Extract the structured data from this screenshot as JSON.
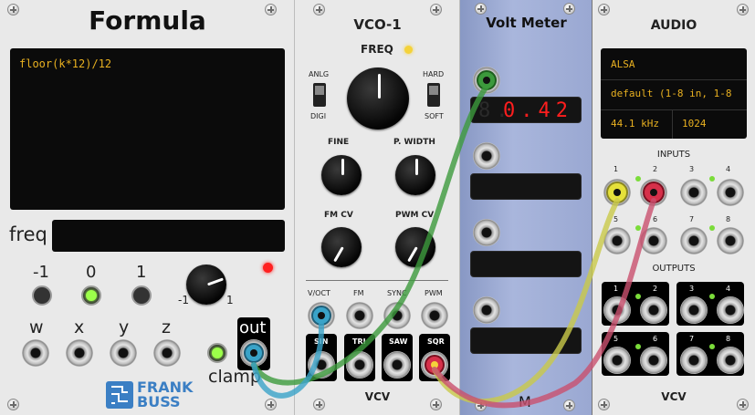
{
  "formula": {
    "title": "Formula",
    "expression": "floor(k*12)/12",
    "freq_label": "freq",
    "const_labels": [
      "-1",
      "0",
      "1"
    ],
    "knob_min": "-1",
    "knob_max": "1",
    "var_labels": [
      "w",
      "x",
      "y",
      "z"
    ],
    "out_label": "out",
    "clamp_label": "clamp",
    "brand_top": "FRANK",
    "brand_bottom": "BUSS"
  },
  "vco": {
    "title": "VCO-1",
    "freq_label": "FREQ",
    "switch1_top": "ANLG",
    "switch1_bottom": "DIGI",
    "switch2_top": "HARD",
    "switch2_bottom": "SOFT",
    "fine_label": "FINE",
    "pwidth_label": "P. WIDTH",
    "fmcv_label": "FM CV",
    "pwmcv_label": "PWM CV",
    "input_labels": [
      "V/OCT",
      "FM",
      "SYNC",
      "PWM"
    ],
    "output_labels": [
      "SIN",
      "TRI",
      "SAW",
      "SQR"
    ],
    "brand": "VCV"
  },
  "voltmeter": {
    "title": "Volt Meter",
    "reading": "0.42",
    "ghost": "8.",
    "brand_mark": "M"
  },
  "audio": {
    "title": "AUDIO",
    "driver": "ALSA",
    "device": "default (1-8 in, 1-8",
    "sample_rate": "44.1 kHz",
    "block_size": "1024",
    "inputs_label": "INPUTS",
    "outputs_label": "OUTPUTS",
    "channel_numbers": [
      "1",
      "2",
      "3",
      "4",
      "5",
      "6",
      "7",
      "8"
    ],
    "brand": "VCV"
  },
  "cables": [
    {
      "name": "Formula out to Volt Meter in 1",
      "color": "#3c9a3c"
    },
    {
      "name": "VCO SQR to Audio input 1",
      "color": "#c9c94a"
    },
    {
      "name": "VCO SQR to Audio input 2",
      "color": "#c9506e"
    },
    {
      "name": "Formula out to VCO V/OCT",
      "color": "#3aa3c8"
    }
  ]
}
